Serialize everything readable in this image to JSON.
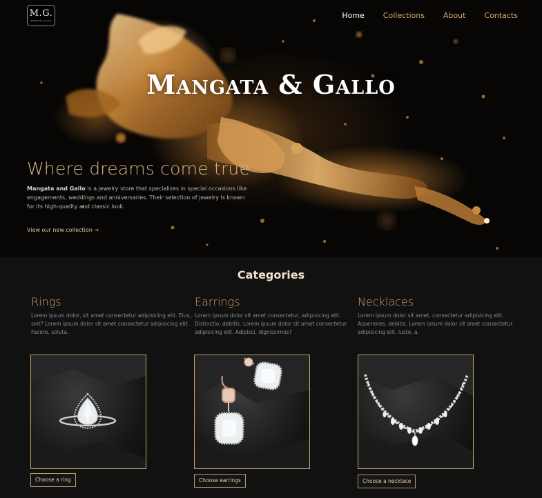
{
  "logo": {
    "mark": "M.G.",
    "sub": "MANGATA GALLO"
  },
  "nav": {
    "items": [
      {
        "label": "Home",
        "active": true
      },
      {
        "label": "Collections",
        "active": false
      },
      {
        "label": "About",
        "active": false
      },
      {
        "label": "Contacts",
        "active": false
      }
    ]
  },
  "hero": {
    "brand": "Mangata & Gallo",
    "tagline": "Where dreams come true",
    "intro_bold": "Mangata and Gallo",
    "intro_rest": " is a jewelry store that specializes in special occasions like engagements, weddings and anniversaries. Their selection of jewelry is known for its high-quality and classic look.",
    "cta": "View our new collection →"
  },
  "categories": {
    "title": "Categories",
    "items": [
      {
        "name": "Rings",
        "description": "Lorem ipsum dolor, sit amet consectetur adipisicing elit. Eius, sint? Lorem ipsum dolor sit amet consectetur adipisicing elit. Facere, soluta.",
        "button": "Choose a ring",
        "image_icon": "diamond-ring-icon"
      },
      {
        "name": "Earrings",
        "description": "Lorem ipsum dolor sit amet consectetur, adipisicing elit. Distinctio, debitis. Lorem ipsum dolor sit amet consectetur adipisicing elit. Adipisci, dignissimos?",
        "button": "Choose earrings",
        "image_icon": "diamond-earrings-icon"
      },
      {
        "name": "Necklaces",
        "description": "Lorem ipsum dolor sit amet, consectetur adipisicing elit. Asperiores, debitis. Lorem ipsum dolor sit amet consectetur adipisicing elit. Iusto, a.",
        "button": "Choose a necklace",
        "image_icon": "diamond-necklace-icon"
      }
    ]
  },
  "colors": {
    "background": "#111111",
    "accent_gold": "#d6a46b",
    "nav_active": "#ffffff"
  }
}
